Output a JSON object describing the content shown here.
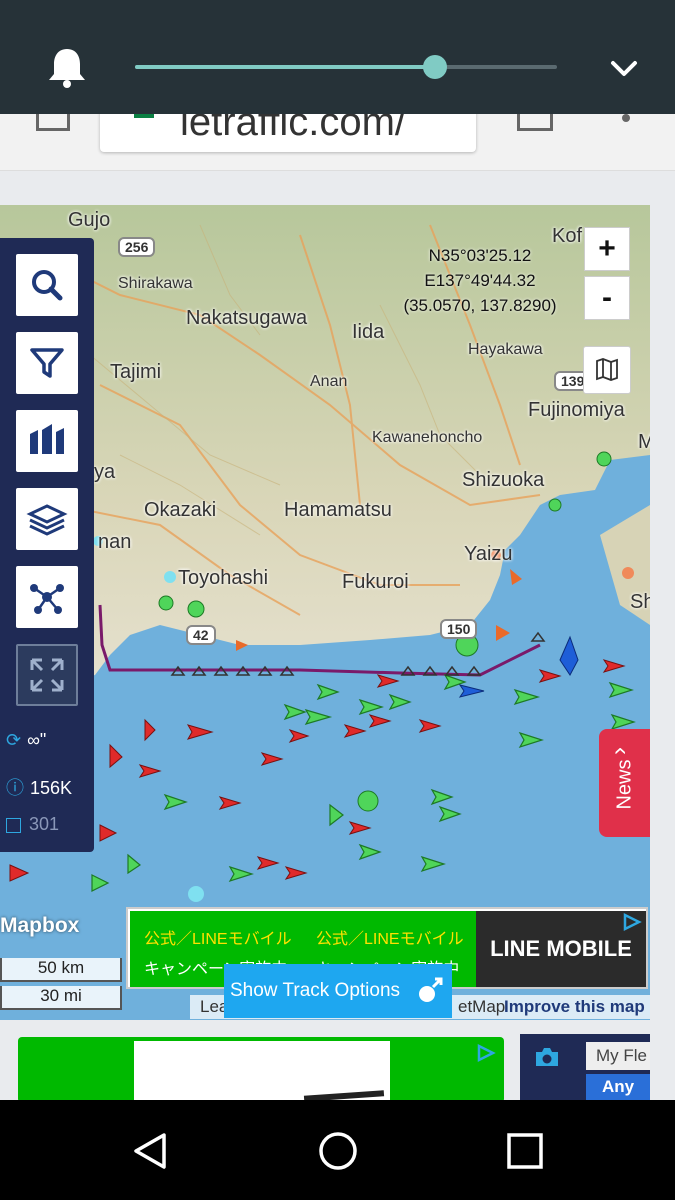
{
  "status_bar": {
    "volume_level": 0.71,
    "icons": [
      "bell-icon",
      "chevron-down-icon"
    ]
  },
  "browser": {
    "url_fragment": "letraffic.com/"
  },
  "map": {
    "coordinates": {
      "lat_dms": "N35°03'25.12",
      "lon_dms": "E137°49'44.32",
      "decimal": "(35.0570, 137.8290)"
    },
    "places": {
      "gujo": "Gujo",
      "kofu": "Kof",
      "shirakawa": "Shirakawa",
      "nakatsugawa": "Nakatsugawa",
      "iida": "Iida",
      "hayakawa": "Hayakawa",
      "tajimi": "Tajimi",
      "anan": "Anan",
      "fujinomiya": "Fujinomiya",
      "kawanehoncho": "Kawanehoncho",
      "ya": "ya",
      "shizuoka": "Shizuoka",
      "okazaki": "Okazaki",
      "hamamatsu": "Hamamatsu",
      "nan": "nan",
      "yaizu": "Yaizu",
      "toyohashi": "Toyohashi",
      "fukuroi": "Fukuroi",
      "sh": "Sh",
      "m": "M"
    },
    "roads": [
      "256",
      "42",
      "150",
      "139"
    ],
    "zoom_in": "+",
    "zoom_out": "-",
    "mapbox_label": "Mapbox",
    "scale_km": "50 km",
    "scale_mi": "30 mi",
    "attribution_left": "Lea",
    "attribution_right": "etMap",
    "improve_link": "Improve this map"
  },
  "sidebar": {
    "buttons": [
      "search-icon",
      "filter-icon",
      "fleet-icon",
      "layers-icon",
      "network-icon",
      "fullscreen-icon"
    ],
    "refresh_label": "∞\"",
    "vessel_count": "156K",
    "checkbox_count": "301"
  },
  "news_tab": {
    "label": "News",
    "arrow": "‹"
  },
  "ad": {
    "text1": "公式／LINEモバイル",
    "text2": "キャンペーン実施中",
    "brand": "LINE MOBILE"
  },
  "track_button": {
    "label": "Show Track Options"
  },
  "fleet": {
    "placeholder": "My Fle",
    "any": "Any"
  },
  "nav_bar": {
    "buttons": [
      "back-icon",
      "home-icon",
      "recents-icon"
    ]
  }
}
